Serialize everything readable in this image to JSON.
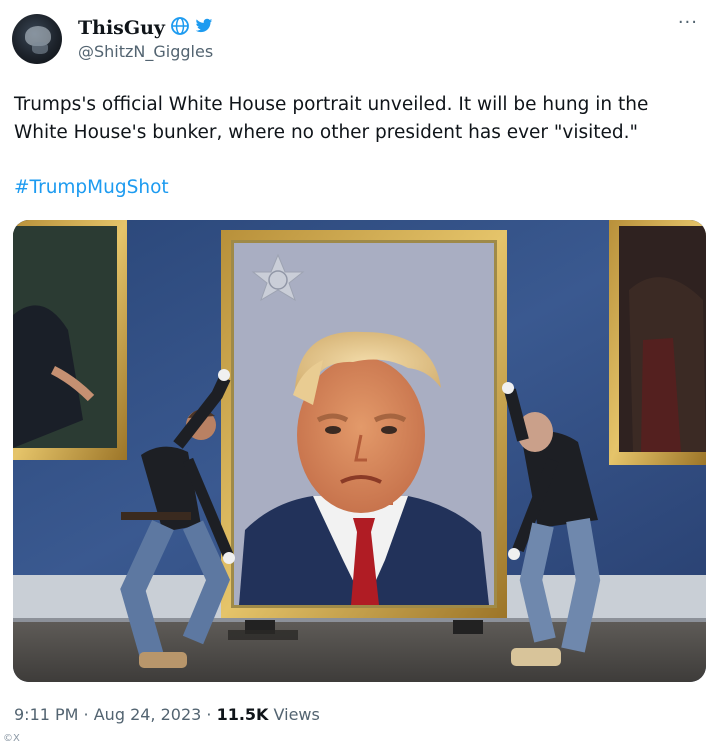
{
  "author": {
    "display_name": "ThisGuy",
    "handle": "@ShitzN_Giggles"
  },
  "more_label": "···",
  "tweet": {
    "line1": "Trumps's official White House portrait unveiled. It will be hung in the",
    "line2": "White House's bunker, where no other president has ever \"visited.\"",
    "hashtag": "#TrumpMugShot"
  },
  "meta": {
    "time": "9:11 PM",
    "sep1": " · ",
    "date": "Aug 24, 2023",
    "sep2": " · ",
    "views_count": "11.5K",
    "views_label": " Views"
  },
  "watermark": "©X",
  "icons": [
    "globe-icon",
    "twitter-bird-icon",
    "more-icon"
  ],
  "colors": {
    "link": "#1d9bf0",
    "secondary": "#536471",
    "wall": "#2f4a78"
  }
}
